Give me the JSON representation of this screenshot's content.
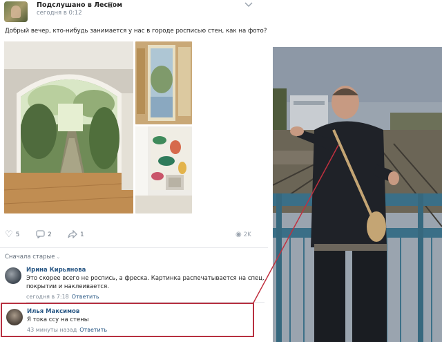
{
  "post": {
    "group_name": "Подслушано в Лесном",
    "time": "сегодня в 0:12",
    "text": "Добрый вечер, кто-нибудь занимается у нас в городе росписью стен, как на фото?",
    "likes": "5",
    "comments": "2",
    "shares": "1",
    "views": "2K"
  },
  "comments_section": {
    "sort_label": "Сначала старые",
    "items": [
      {
        "author": "Ирина Кирьянова",
        "text": "Это скорее всего не роспись, а фреска. Картинка распечатывается на спец. покрытии и наклеивается.",
        "time": "сегодня в 7:18",
        "reply": "Ответить"
      },
      {
        "author": "Илья Максимов",
        "text": "Я тока ссу на стены",
        "time": "43 минуты назад",
        "reply": "Ответить"
      }
    ]
  },
  "icons": {
    "like": "heart-icon",
    "comment": "comment-icon",
    "share": "share-icon",
    "views": "eye-icon",
    "more": "chevron-down-icon"
  },
  "colors": {
    "link": "#2a5885",
    "muted": "#818c99",
    "highlight_frame": "#b73040"
  }
}
